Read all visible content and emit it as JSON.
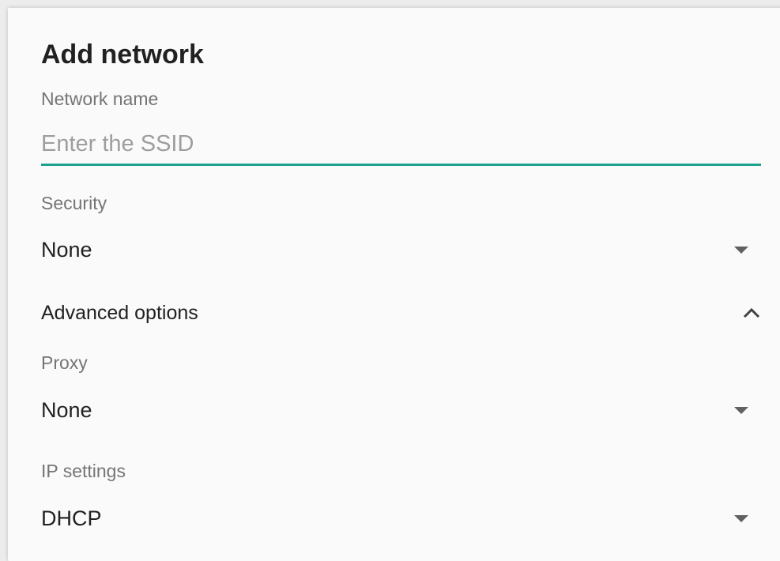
{
  "dialog": {
    "title": "Add network"
  },
  "network_name": {
    "label": "Network name",
    "value": "",
    "placeholder": "Enter the SSID"
  },
  "security": {
    "label": "Security",
    "selected": "None"
  },
  "advanced": {
    "label": "Advanced options",
    "expanded": true
  },
  "proxy": {
    "label": "Proxy",
    "selected": "None"
  },
  "ip_settings": {
    "label": "IP settings",
    "selected": "DHCP"
  },
  "colors": {
    "accent": "#1ea28d",
    "background": "#fafafa",
    "text_primary": "#212121",
    "text_secondary": "#757575"
  },
  "icons": {
    "dropdown": "caret-down-icon",
    "collapse": "chevron-up-icon"
  }
}
